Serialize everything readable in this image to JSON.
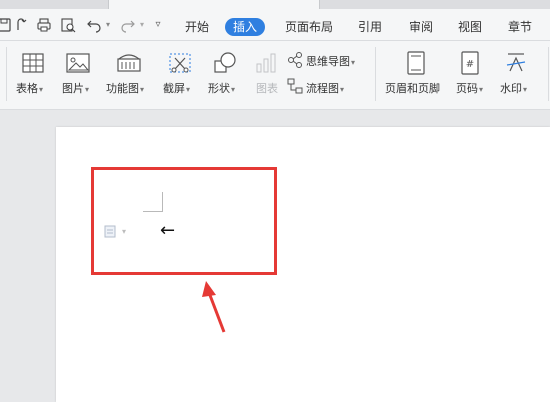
{
  "window": {
    "title": ""
  },
  "menu": {
    "items": [
      "开始",
      "插入",
      "页面布局",
      "引用",
      "审阅",
      "视图",
      "章节"
    ],
    "active_index": 1,
    "active_color": "#2f7fe0"
  },
  "quick_access": {
    "icons": [
      "redo-copy-icon",
      "print-icon",
      "print-preview-icon",
      "undo-icon",
      "redo-icon",
      "dropdown-icon"
    ]
  },
  "toolbar": {
    "table_label": "表格",
    "picture_label": "图片",
    "function_chart_label": "功能图",
    "screenshot_label": "截屏",
    "shapes_label": "形状",
    "chart_label": "图表",
    "mindmap_label": "思维导图",
    "flowchart_label": "流程图",
    "header_footer_label": "页眉和页脚",
    "page_number_label": "页码",
    "watermark_label": "水印"
  },
  "document": {
    "annotation_color": "#e53935",
    "return_symbol": "←"
  }
}
